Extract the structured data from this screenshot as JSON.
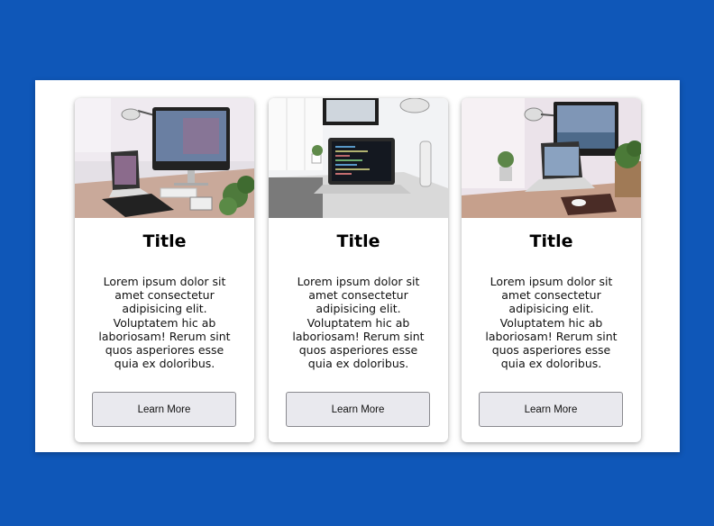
{
  "cards": [
    {
      "title": "Title",
      "text": "Lorem ipsum dolor sit amet consectetur adipisicing elit. Voluptatem hic ab laboriosam! Rerum sint quos asperiores esse quia ex doloribus.",
      "button_label": "Learn More",
      "image": "desk-imac-workspace-photo"
    },
    {
      "title": "Title",
      "text": "Lorem ipsum dolor sit amet consectetur adipisicing elit. Voluptatem hic ab laboriosam! Rerum sint quos asperiores esse quia ex doloribus.",
      "button_label": "Learn More",
      "image": "laptop-code-workspace-photo"
    },
    {
      "title": "Title",
      "text": "Lorem ipsum dolor sit amet consectetur adipisicing elit. Voluptatem hic ab laboriosam! Rerum sint quos asperiores esse quia ex doloribus.",
      "button_label": "Learn More",
      "image": "desk-laptop-plants-photo"
    }
  ],
  "colors": {
    "background": "#0f57b8",
    "panel": "#ffffff",
    "button_bg": "#e9e9ee",
    "button_border": "#8a8a8f"
  }
}
